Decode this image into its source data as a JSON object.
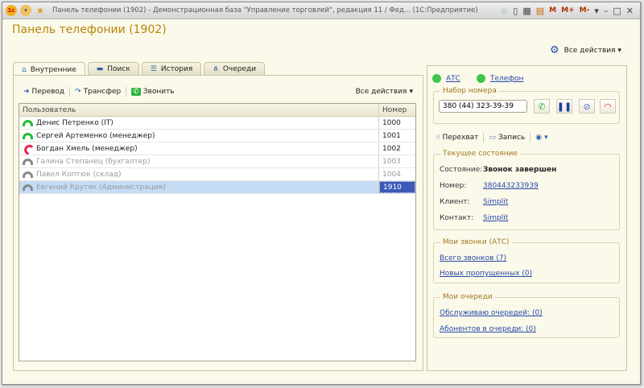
{
  "window": {
    "title": "Панель телефонии (1902) - Демонстрационная база \"Управление торговлей\", редакция 11 / Фед... (1С:Предприятие)",
    "mem_buttons": [
      "M",
      "M+",
      "M-"
    ]
  },
  "page": {
    "title": "Панель телефонии (1902)",
    "all_actions": "Все действия"
  },
  "tabs": [
    {
      "label": "Внутренние",
      "icon": "home-icon"
    },
    {
      "label": "Поиск",
      "icon": "briefcase-icon"
    },
    {
      "label": "История",
      "icon": "list-icon"
    },
    {
      "label": "Очереди",
      "icon": "hierarchy-icon"
    }
  ],
  "toolbar": {
    "transfer": "Перевод",
    "forward": "Трансфер",
    "call": "Звонить",
    "all_actions": "Все действия"
  },
  "table": {
    "columns": [
      "Пользователь",
      "Номер"
    ],
    "rows": [
      {
        "user": "Денис Петренко (IT)",
        "number": "1000",
        "status": "free",
        "color": "#22bb33"
      },
      {
        "user": "Сергей Артеменко (менеджер)",
        "number": "1001",
        "status": "free",
        "color": "#22bb33"
      },
      {
        "user": "Богдан Хмель (менеджер)",
        "number": "1002",
        "status": "busy",
        "color": "#ee2244"
      },
      {
        "user": "Галина Степанец (бухгалтер)",
        "number": "1003",
        "status": "offline",
        "color": "#888888"
      },
      {
        "user": "Павел Коптюк (склад)",
        "number": "1004",
        "status": "offline",
        "color": "#888888"
      },
      {
        "user": "Евгений Крутяк (Администрация)",
        "number": "1910",
        "status": "offline",
        "color": "#888888",
        "selected": true
      }
    ]
  },
  "right": {
    "pbx": "АТС",
    "phone": "Телефон",
    "dial": {
      "legend": "Набор номера",
      "value": "380 (44) 323-39-39"
    },
    "actions": {
      "intercept": "Перехват",
      "record": "Запись"
    },
    "state": {
      "legend": "Текущее состояние",
      "state_label": "Состояние:",
      "state_value": "Звонок завершен",
      "number_label": "Номер:",
      "number_value": "380443233939",
      "client_label": "Клиент:",
      "client_value": "Simplit",
      "contact_label": "Контакт:",
      "contact_value": "Simplit"
    },
    "calls": {
      "legend": "Мои звонки (АТС)",
      "total": "Всего звонков (7)",
      "missed": "Новых пропущенных (0)"
    },
    "queues": {
      "legend": "Мои очереди",
      "serving": "Обслуживаю очередей: (0)",
      "subscribers": "Абонентов в очереди: (0)"
    }
  }
}
